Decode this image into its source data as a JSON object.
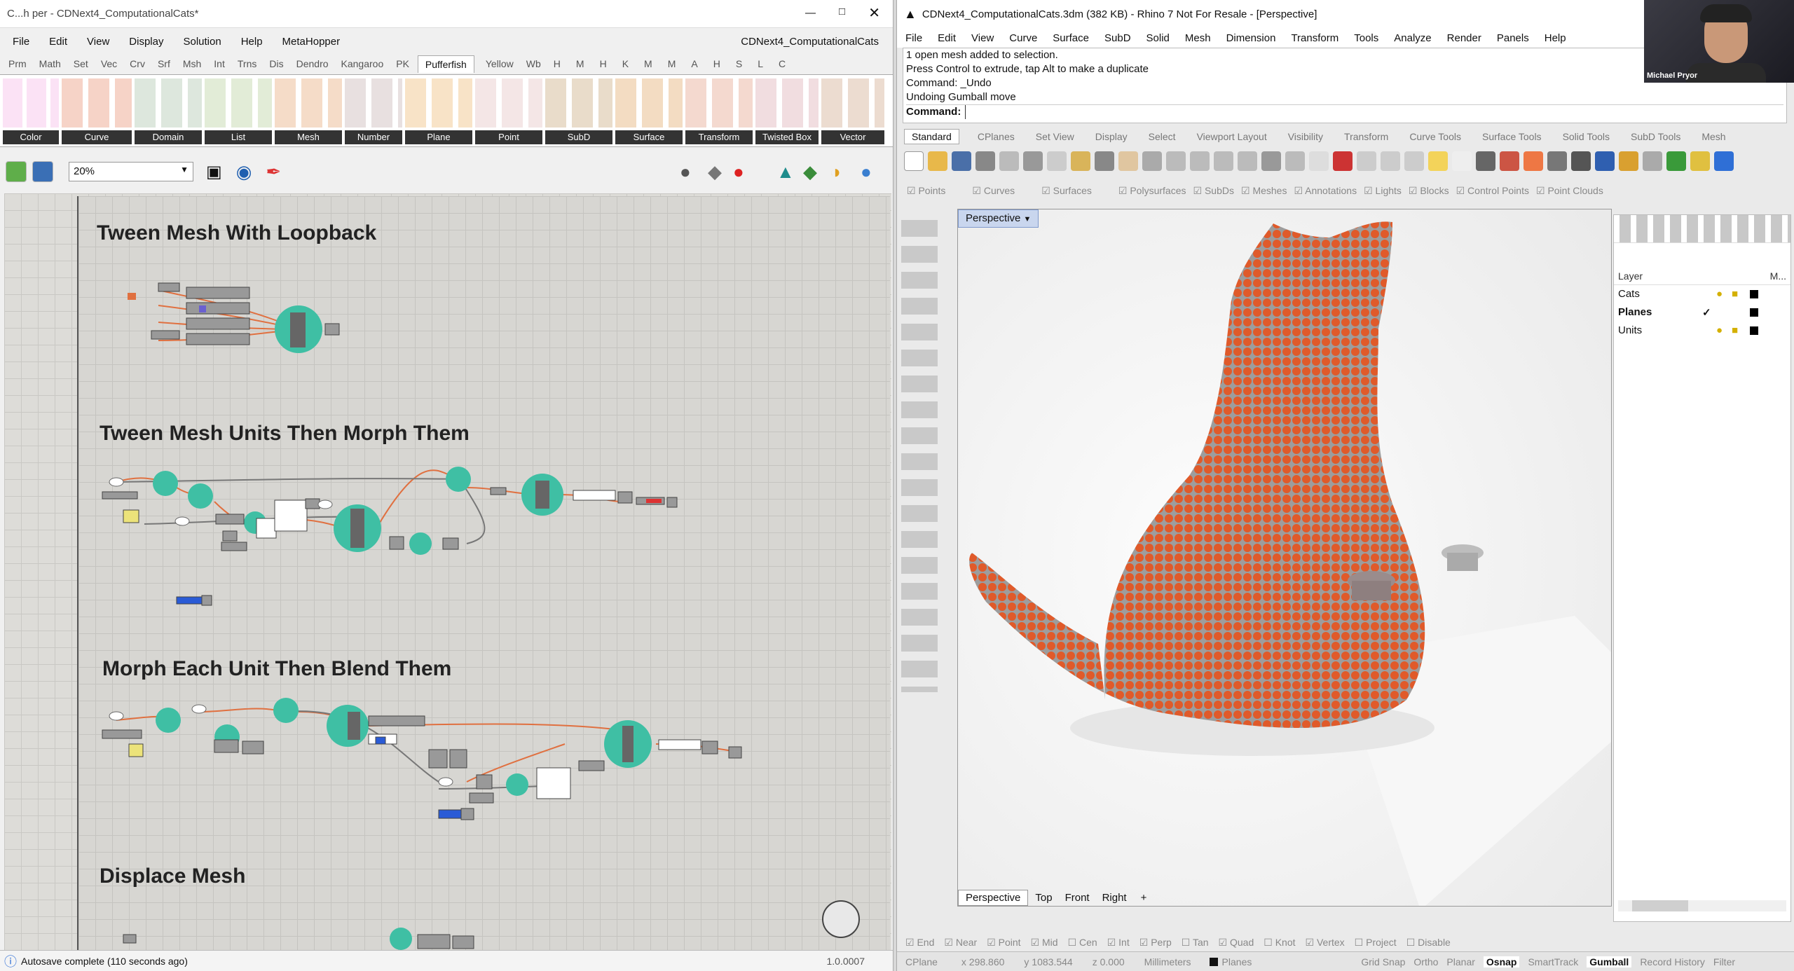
{
  "gh": {
    "title": "C...h   per - CDNext4_ComputationalCats*",
    "doc_name": "CDNext4_ComputationalCats",
    "menu": [
      "File",
      "Edit",
      "View",
      "Display",
      "Solution",
      "Help",
      "MetaHopper"
    ],
    "tabs": [
      "Prm",
      "Math",
      "Set",
      "Vec",
      "Crv",
      "Srf",
      "Msh",
      "Int",
      "Trns",
      "Dis",
      "Dendro",
      "Kangaroo",
      "PK",
      "Pufferfish",
      "Yellow",
      "Wb",
      "H",
      "M",
      "H",
      "K",
      "M",
      "M",
      "A",
      "H",
      "S",
      "L",
      "C"
    ],
    "active_tab": "Pufferfish",
    "groups": [
      "Color",
      "Curve",
      "Domain",
      "List",
      "Mesh",
      "Number",
      "Plane",
      "Point",
      "SubD",
      "Surface",
      "Transform",
      "Twisted Box",
      "Vector"
    ],
    "zoom": "20%",
    "sections": [
      "Tween Mesh With Loopback",
      "Tween Mesh Units Then Morph Them",
      "Morph Each Unit Then Blend Them",
      "Displace Mesh"
    ],
    "status": "Autosave complete (110 seconds ago)",
    "version": "1.0.0007"
  },
  "rh": {
    "title": "CDNext4_ComputationalCats.3dm (382 KB) - Rhino 7 Not For Resale - [Perspective]",
    "menu": [
      "File",
      "Edit",
      "View",
      "Curve",
      "Surface",
      "SubD",
      "Solid",
      "Mesh",
      "Dimension",
      "Transform",
      "Tools",
      "Analyze",
      "Render",
      "Panels",
      "Help"
    ],
    "history": [
      "1 open mesh added to selection.",
      "Press Control to extrude, tap Alt to make a duplicate",
      "Command: _Undo",
      "Undoing Gumball move"
    ],
    "command_label": "Command:",
    "presenter": "Michael Pryor",
    "toolbar_tabs": [
      "Standard",
      "CPlanes",
      "Set View",
      "Display",
      "Select",
      "Viewport Layout",
      "Visibility",
      "Transform",
      "Curve Tools",
      "Surface Tools",
      "Solid Tools",
      "SubD Tools",
      "Mesh"
    ],
    "filters": [
      "Points",
      "Curves",
      "Surfaces",
      "Polysurfaces",
      "SubDs",
      "Meshes",
      "Annotations",
      "Lights",
      "Blocks",
      "Control Points",
      "Point Clouds"
    ],
    "viewport_label": "Perspective",
    "view_tabs": [
      "Perspective",
      "Top",
      "Front",
      "Right",
      "+"
    ],
    "layers_header": "Layer",
    "layers_col": "M...",
    "layers": [
      "Cats",
      "Planes",
      "Units"
    ],
    "osnaps": [
      "End",
      "Near",
      "Point",
      "Mid",
      "Cen",
      "Int",
      "Perp",
      "Tan",
      "Quad",
      "Knot",
      "Vertex",
      "Project",
      "Disable"
    ],
    "status": {
      "cplane": "CPlane",
      "x": "x 298.860",
      "y": "y 1083.544",
      "z": "z 0.000",
      "units": "Millimeters",
      "layer": "Planes"
    },
    "status_toggles": [
      "Grid Snap",
      "Ortho",
      "Planar",
      "Osnap",
      "SmartTrack",
      "Gumball",
      "Record History",
      "Filter"
    ]
  },
  "colors": {
    "accent": "#2f6fd6",
    "node": "#3fbfa4",
    "wire": "#e07040",
    "cat": "#e05a2a"
  }
}
